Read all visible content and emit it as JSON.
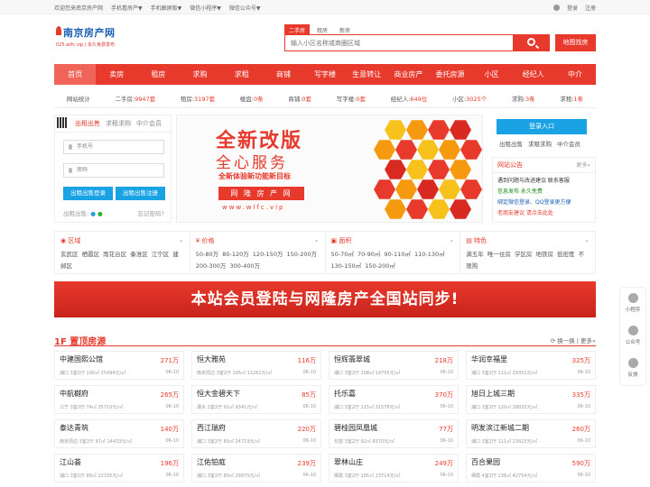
{
  "topbar": {
    "welcome": "欢迎您来南京房产网",
    "links": [
      "手机看房产▼",
      "手机触屏版▼",
      "微信小程序▼",
      "微信公众号▼"
    ],
    "login": "登录",
    "register": "注册"
  },
  "logo": {
    "name": "南京房产网",
    "domain": "025.wlfc.vip",
    "slogan": "永久免费发布"
  },
  "search": {
    "tabs": [
      "二手房",
      "租房",
      "新房"
    ],
    "placeholder": "输入小区名称或商圈区域",
    "map_label": "地图找房"
  },
  "nav": [
    "首页",
    "卖房",
    "租房",
    "求购",
    "求租",
    "商铺",
    "写字楼",
    "生意转让",
    "商业房产",
    "委托房源",
    "小区",
    "经纪人",
    "中介"
  ],
  "stats": [
    {
      "label": "网站统计",
      "value": ""
    },
    {
      "label": "二手房:",
      "value": "9947套"
    },
    {
      "label": "租房:",
      "value": "3197套"
    },
    {
      "label": "楼盘:",
      "value": "0条"
    },
    {
      "label": "商铺:",
      "value": "0套"
    },
    {
      "label": "写字楼:",
      "value": "0套"
    },
    {
      "label": "经纪人:",
      "value": "649位"
    },
    {
      "label": "小区:",
      "value": "3025个"
    },
    {
      "label": "求购:",
      "value": "3条"
    },
    {
      "label": "求租:",
      "value": "1条"
    }
  ],
  "login": {
    "tabs": [
      "出租出售",
      "求租求购",
      "中介会员"
    ],
    "phone_placeholder": "手机号",
    "password_placeholder": "密码",
    "login_btn": "出租出售登录",
    "register_btn": "出租出售注册",
    "quick": "出租出售:",
    "forgot": "忘记密码?"
  },
  "banner": {
    "line1": "全新改版",
    "line2": "全心服务",
    "line3": "全新体验新功能新目标",
    "line4": "网 隆 房 产 网",
    "line5": "www.wlfc.vip"
  },
  "right": {
    "login_btn": "登录入口",
    "links": [
      "出租出售",
      "求租求购",
      "中介会员"
    ],
    "notice_title": "网站公告",
    "notice_more": "更多»",
    "notices": [
      {
        "text": "遇到问题与改进建议 联系客服",
        "color": "#333333"
      },
      {
        "text": "信息发布 永久免费",
        "color": "#1a8a1a"
      },
      {
        "text": "绑定微信登录、QQ登录更方便",
        "color": "#1a5fb4"
      },
      {
        "text": "老朋友建议 请点击此处",
        "color": "#e8392d"
      }
    ]
  },
  "filters": [
    {
      "title": "区域",
      "items": "玄武区 栖霞区 雨花台区 秦淮区 江宁区 建邺区"
    },
    {
      "title": "价格",
      "items": "50-80万 80-120万 120-150万 150-200万 200-300万 300-400万"
    },
    {
      "title": "面积",
      "items": "50-70㎡ 70-90㎡ 90-110㎡ 110-130㎡ 130-150㎡ 150-200㎡"
    },
    {
      "title": "特色",
      "items": "满五年 唯一住房 学区房 地铁房 低密度 不限购"
    }
  ],
  "ad_text": "本站会员登陆与网隆房产全国站同步!",
  "section": {
    "title": "1F 置顶房源",
    "more": "换一换 | 更多»"
  },
  "listings": [
    {
      "name": "中建国熙公馆",
      "price": "271万",
      "desc": "浦口 3室2厅 100㎡ 25494元/㎡",
      "date": "06-10"
    },
    {
      "name": "恒大雅苑",
      "price": "116万",
      "desc": "南京周边 3室2厅 105㎡ 11262元/㎡",
      "date": "06-10"
    },
    {
      "name": "恒辉翡翠城",
      "price": "218万",
      "desc": "浦口 3室2厅 108㎡ 19755元/㎡",
      "date": "06-10"
    },
    {
      "name": "华润幸福里",
      "price": "325万",
      "desc": "浦口 3室2厅 112㎡ 29351元/㎡",
      "date": "06-10"
    },
    {
      "name": "中航樾府",
      "price": "265万",
      "desc": "江宁 3室2厅 74㎡ 35710元/㎡",
      "date": "06-10"
    },
    {
      "name": "恒大金碧天下",
      "price": "85万",
      "desc": "溧水 2室2厅 91㎡ 9341元/㎡",
      "date": "06-10"
    },
    {
      "name": "托乐嘉",
      "price": "370万",
      "desc": "浦口 3室2厅 115㎡ 31578元/㎡",
      "date": "06-10"
    },
    {
      "name": "旭日上城三期",
      "price": "335万",
      "desc": "浦口 3室2厅 120㎡ 28032元/㎡",
      "date": "06-10"
    },
    {
      "name": "泰达青筑",
      "price": "140万",
      "desc": "南京周边 3室2厅 97㎡ 14433元/㎡",
      "date": "06-10"
    },
    {
      "name": "西江瑞府",
      "price": "220万",
      "desc": "浦口 3室2厅 89㎡ 24719元/㎡",
      "date": "06-10"
    },
    {
      "name": "碧桂园凤凰城",
      "price": "77万",
      "desc": "句容 3室2厅 92㎡ 8370元/㎡",
      "date": "06-10"
    },
    {
      "name": "明发滨江新城二期",
      "price": "260万",
      "desc": "浦口 3室2厅 111㎡ 23423元/㎡",
      "date": "06-10"
    },
    {
      "name": "江山荟",
      "price": "196万",
      "desc": "浦口 3室1厅 88㎡ 22335元/㎡",
      "date": "06-10"
    },
    {
      "name": "江佑铂庭",
      "price": "239万",
      "desc": "浦口 3室2厅 80㎡ 29875元/㎡",
      "date": "06-10"
    },
    {
      "name": "翠林山庄",
      "price": "249万",
      "desc": "栖霞 3室2厅 105㎡ 23714元/㎡",
      "date": "06-10"
    },
    {
      "name": "百合果园",
      "price": "590万",
      "desc": "栖霞 4室2厅 138㎡ 42754元/㎡",
      "date": "06-10"
    }
  ],
  "sidebar": [
    "小程序",
    "公众号",
    "反馈"
  ],
  "colors": {
    "accent": "#e8392d",
    "blue": "#1aa3e4"
  }
}
